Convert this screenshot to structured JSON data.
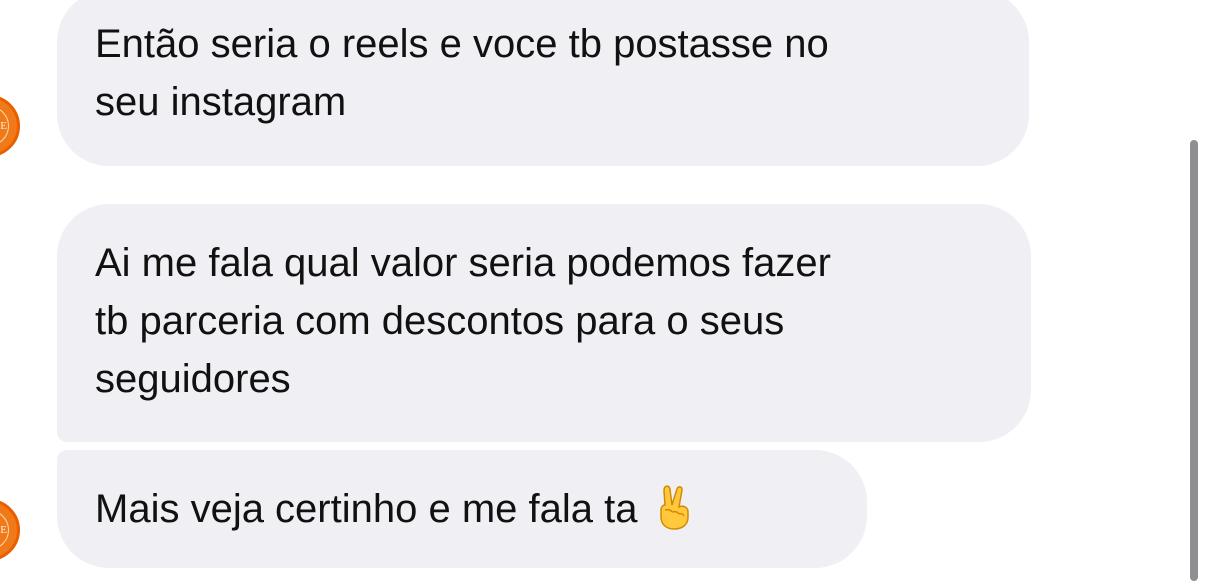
{
  "messages": [
    {
      "lines": [
        "Então seria o reels e voce tb postasse no",
        "seu instagram"
      ]
    },
    {
      "lines": [
        "Ai me fala qual valor seria podemos fazer",
        "tb parceria com descontos para o seus",
        "seguidores"
      ]
    },
    {
      "text": "Mais veja certinho e me fala ta",
      "emoji": "victory-hand-icon"
    }
  ],
  "avatar": {
    "letter": "E",
    "color": "#f07a1a"
  },
  "colors": {
    "bubble": "#efeff4",
    "text": "#111111",
    "scrollbar": "#8e8e93"
  }
}
